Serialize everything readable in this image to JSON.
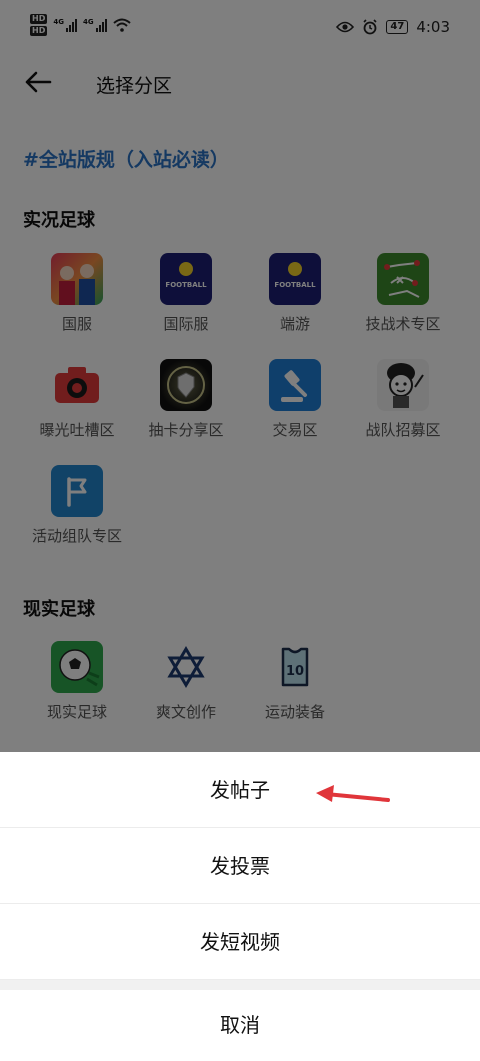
{
  "status": {
    "time": "4:03",
    "battery": "47",
    "hd": "HD",
    "net_type": "4G"
  },
  "header": {
    "title": "选择分区"
  },
  "rules_link": "#全站版规（入站必读）",
  "sections": [
    {
      "title": "实况足球",
      "items": [
        {
          "label": "国服",
          "icon": "pes-cover-icon"
        },
        {
          "label": "国际服",
          "icon": "efootball-icon"
        },
        {
          "label": "端游",
          "icon": "efootball-icon"
        },
        {
          "label": "技战术专区",
          "icon": "tactics-board-icon"
        },
        {
          "label": "曝光吐槽区",
          "icon": "camera-icon"
        },
        {
          "label": "抽卡分享区",
          "icon": "card-shield-icon"
        },
        {
          "label": "交易区",
          "icon": "gavel-icon"
        },
        {
          "label": "战队招募区",
          "icon": "cartoon-character-icon"
        },
        {
          "label": "活动组队专区",
          "icon": "flag-icon"
        }
      ]
    },
    {
      "title": "现实足球",
      "items": [
        {
          "label": "现实足球",
          "icon": "soccer-ball-icon"
        },
        {
          "label": "爽文创作",
          "icon": "star-of-david-icon"
        },
        {
          "label": "运动装备",
          "icon": "jersey-10-icon"
        }
      ]
    }
  ],
  "sheet": {
    "options": [
      "发帖子",
      "发投票",
      "发短视频"
    ],
    "cancel": "取消"
  },
  "efootball_text": "FOOTBALL",
  "jersey_number": "10",
  "colors": {
    "link": "#2a73c4",
    "arrow": "#e0353a"
  }
}
